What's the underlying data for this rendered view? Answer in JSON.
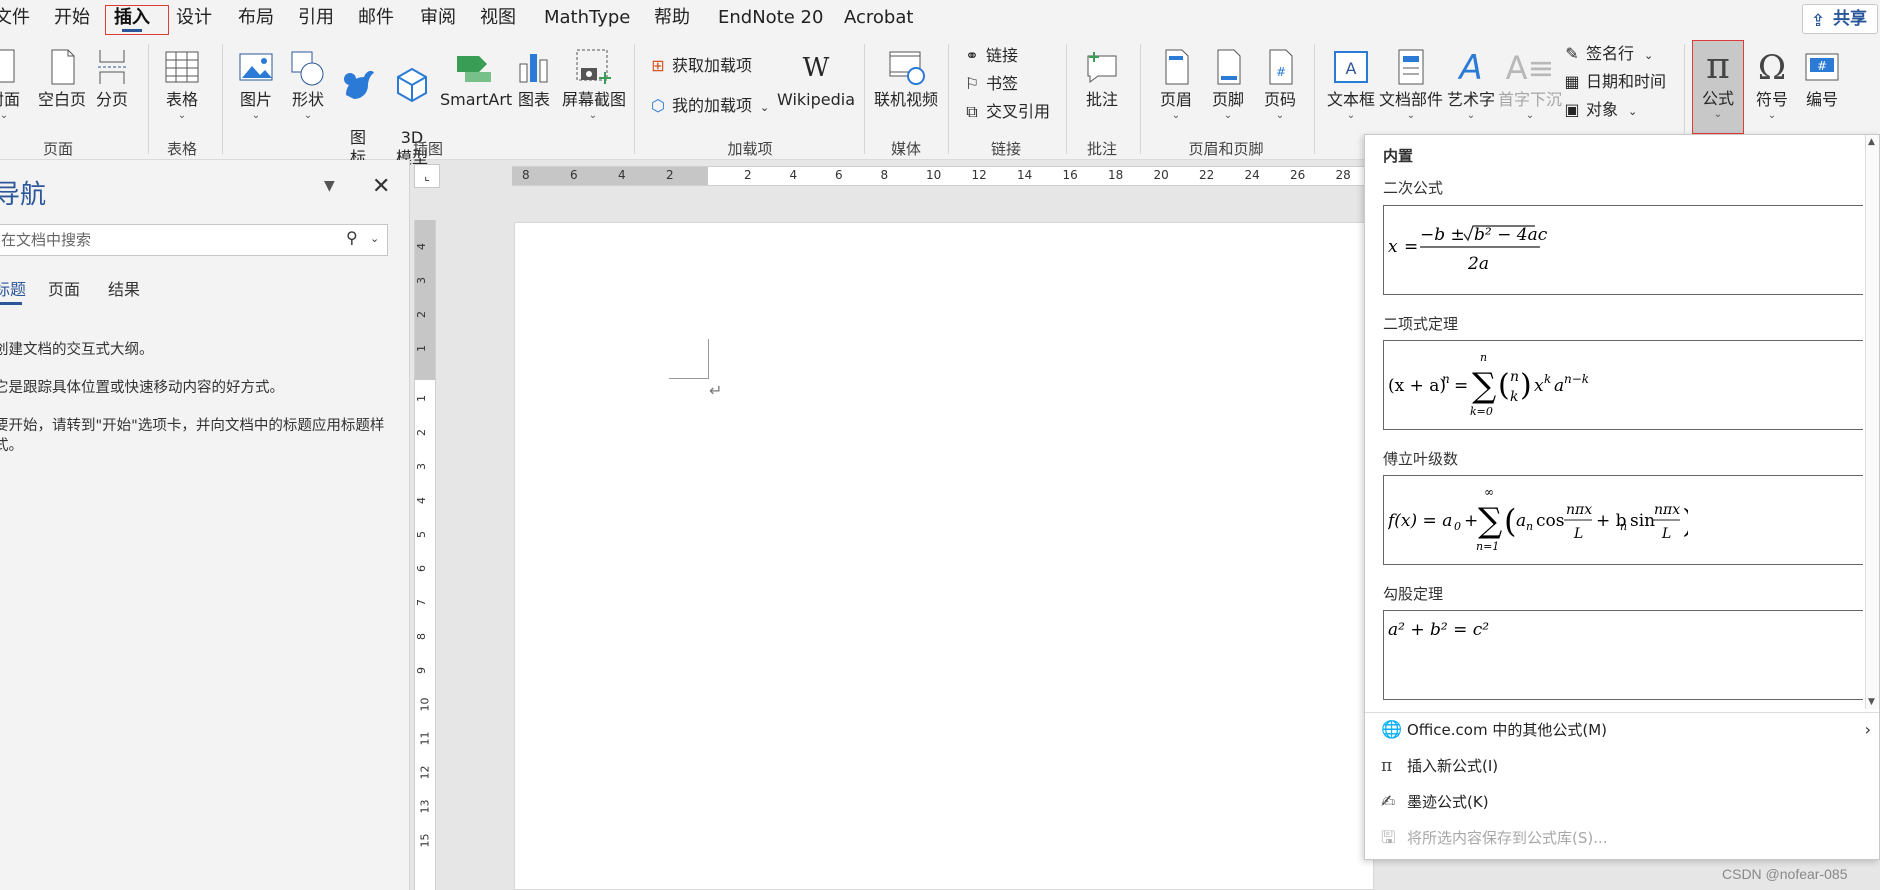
{
  "menubar": {
    "items": [
      "文件",
      "开始",
      "插入",
      "设计",
      "布局",
      "引用",
      "邮件",
      "审阅",
      "视图",
      "MathType",
      "帮助",
      "EndNote 20",
      "Acrobat"
    ],
    "share": "共享"
  },
  "ribbon": {
    "pages": {
      "cover": "封面",
      "blank": "空白页",
      "break": "分页",
      "group": "页面"
    },
    "tables": {
      "table": "表格",
      "group": "表格"
    },
    "illustrations": {
      "picture": "图片",
      "shapes": "形状",
      "icons": "图\n标",
      "model3d": "3D\n模型",
      "smartart": "SmartArt",
      "chart": "图表",
      "screenshot": "屏幕截图",
      "group": "插图"
    },
    "addins": {
      "get": "获取加载项",
      "my": "我的加载项",
      "wikipedia": "Wikipedia",
      "group": "加载项"
    },
    "media": {
      "video": "联机视频",
      "group": "媒体"
    },
    "links": {
      "link": "链接",
      "bookmark": "书签",
      "crossref": "交叉引用",
      "group": "链接"
    },
    "comments": {
      "comment": "批注",
      "group": "批注"
    },
    "headerfooter": {
      "header": "页眉",
      "footer": "页脚",
      "pagenum": "页码",
      "group": "页眉和页脚"
    },
    "text": {
      "textbox": "文本框",
      "parts": "文档部件",
      "wordart": "艺术字",
      "dropcap": "首字下沉",
      "signature": "签名行",
      "datetime": "日期和时间",
      "object": "对象"
    },
    "symbols": {
      "equation": "公式",
      "symbol": "符号",
      "number": "编号"
    }
  },
  "nav": {
    "title": "导航",
    "search_placeholder": "在文档中搜索",
    "tabs": [
      "标题",
      "页面",
      "结果"
    ],
    "p1": "创建文档的交互式大纲。",
    "p2": "它是跟踪具体位置或快速移动内容的好方式。",
    "p3": "要开始，请转到\"开始\"选项卡，并向文档中的标题应用标题样式。"
  },
  "ruler": {
    "h": [
      "8",
      "6",
      "4",
      "2",
      "2",
      "4",
      "6",
      "8",
      "10",
      "12",
      "14",
      "16",
      "18",
      "20",
      "22",
      "24",
      "26",
      "28"
    ],
    "v": [
      "4",
      "3",
      "2",
      "1",
      "1",
      "2",
      "3",
      "4",
      "5",
      "6",
      "7",
      "8",
      "9",
      "10",
      "11",
      "12",
      "13",
      "15"
    ]
  },
  "gallery": {
    "header": "内置",
    "eq1_name": "二次公式",
    "eq2_name": "二项式定理",
    "eq3_name": "傅立叶级数",
    "eq4_name": "勾股定理",
    "more": "Office.com 中的其他公式(M)",
    "insert_new": "插入新公式(I)",
    "ink": "墨迹公式(K)",
    "save": "将所选内容保存到公式库(S)..."
  },
  "watermark": "CSDN @nofear-085",
  "colors": {
    "accent": "#2b579a",
    "highlight_border": "#e03a3a"
  }
}
